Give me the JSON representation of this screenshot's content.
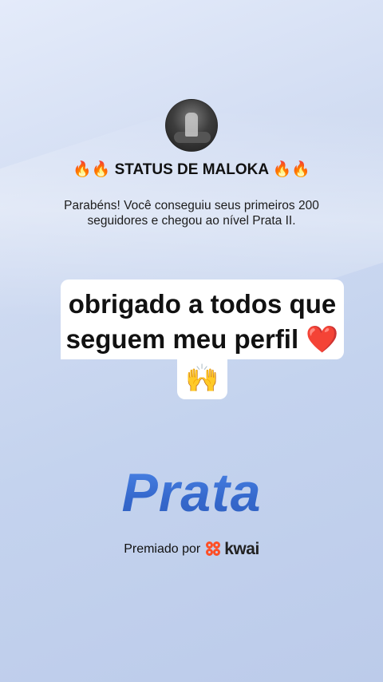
{
  "profile": {
    "title": "🔥🔥 STATUS DE MALOKA 🔥🔥",
    "message": "Parabéns! Você conseguiu seus primeiros 200 seguidores e chegou ao nível Prata II."
  },
  "caption": {
    "line1": "obrigado a todos que",
    "line2_text": "seguem meu perfil ",
    "line2_heart": "❤️",
    "line3": "🙌"
  },
  "badge": {
    "level": "Prata"
  },
  "footer": {
    "awarded_by": "Premiado por",
    "brand": "kwai"
  },
  "colors": {
    "level_blue": "#3f6fd4",
    "kwai_orange": "#ff4f26"
  }
}
